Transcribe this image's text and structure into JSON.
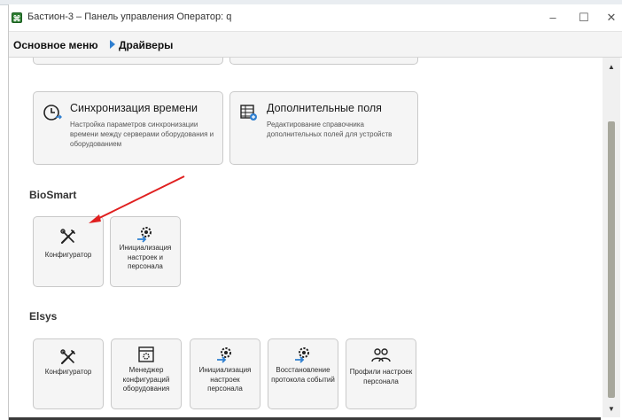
{
  "window": {
    "title": "Бастион-3 – Панель управления Оператор: q",
    "controls": {
      "minimize": "–",
      "maximize": "☐",
      "close": "✕"
    }
  },
  "breadcrumb": {
    "root": "Основное меню",
    "current": "Драйверы"
  },
  "top_cards": [
    {
      "title": "Синхронизация времени",
      "description": "Настройка параметров синхронизации времени между серверами оборудования и оборудованием",
      "icon": "clock-sync-icon"
    },
    {
      "title": "Дополнительные поля",
      "description": "Редактирование справочника дополнительных полей для устройств",
      "icon": "table-fields-icon"
    }
  ],
  "sections": [
    {
      "title": "BioSmart",
      "tiles": [
        {
          "label": "Конфигуратор",
          "icon": "tools-icon"
        },
        {
          "label": "Инициализация настроек и персонала",
          "icon": "gear-arrow-icon"
        }
      ]
    },
    {
      "title": "Elsys",
      "tiles": [
        {
          "label": "Конфигуратор",
          "icon": "tools-icon"
        },
        {
          "label": "Менеджер конфигураций оборудования",
          "icon": "config-manager-icon"
        },
        {
          "label": "Инициализация настроек персонала",
          "icon": "gear-arrow-icon"
        },
        {
          "label": "Восстановление протокола событий",
          "icon": "gear-arrow-icon"
        },
        {
          "label": "Профили настроек персонала",
          "icon": "people-icon"
        }
      ]
    }
  ],
  "colors": {
    "accent": "#2f7fd0",
    "annotation_arrow": "#e02020"
  }
}
